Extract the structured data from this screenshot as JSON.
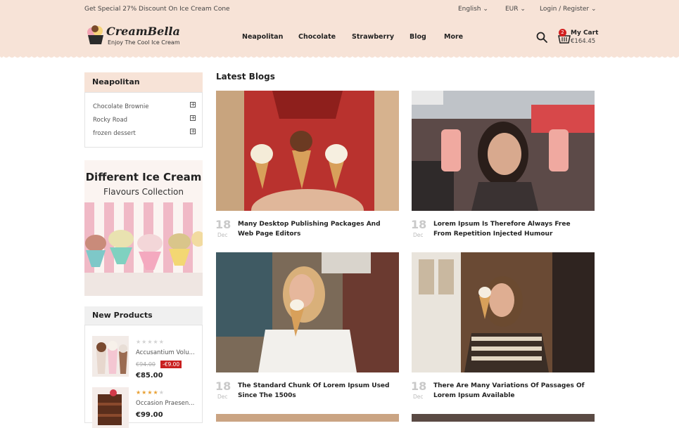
{
  "topbar": {
    "promo": "Get Special 27% Discount On Ice Cream Cone",
    "language": "English",
    "currency": "EUR",
    "account": "Login / Register"
  },
  "brand": {
    "name": "CreamBella",
    "tagline": "Enjoy The Cool Ice Cream"
  },
  "nav": [
    "Neapolitan",
    "Chocolate",
    "Strawberry",
    "Blog",
    "More"
  ],
  "cart": {
    "count": "2",
    "label": "My Cart",
    "total": "€164.45"
  },
  "sidebar": {
    "categories_title": "Neapolitan",
    "categories": [
      "Chocolate Brownie",
      "Rocky Road",
      "frozen dessert"
    ],
    "banner": {
      "title": "Different Ice Cream",
      "subtitle": "Flavours Collection"
    },
    "new_products_title": "New Products",
    "products": [
      {
        "name": "Accusantium Volu...",
        "old_price": "€94.00",
        "discount": "-€9.00",
        "price": "€85.00",
        "rating": 0
      },
      {
        "name": "Occasion Praesen...",
        "price": "€99.00",
        "rating": 4
      }
    ]
  },
  "main": {
    "title": "Latest Blogs",
    "posts": [
      {
        "day": "18",
        "month": "Dec",
        "title": "Many Desktop Publishing Packages And Web Page Editors"
      },
      {
        "day": "18",
        "month": "Dec",
        "title": "Lorem Ipsum Is Therefore Always Free From Repetition Injected Humour"
      },
      {
        "day": "18",
        "month": "Dec",
        "title": "The Standard Chunk Of Lorem Ipsum Used Since The 1500s"
      },
      {
        "day": "18",
        "month": "Dec",
        "title": "There Are Many Variations Of Passages Of Lorem Ipsum Available"
      }
    ]
  },
  "colors": {
    "accent": "#f7e3d7",
    "sale": "#c92020",
    "badge": "#d32020"
  }
}
